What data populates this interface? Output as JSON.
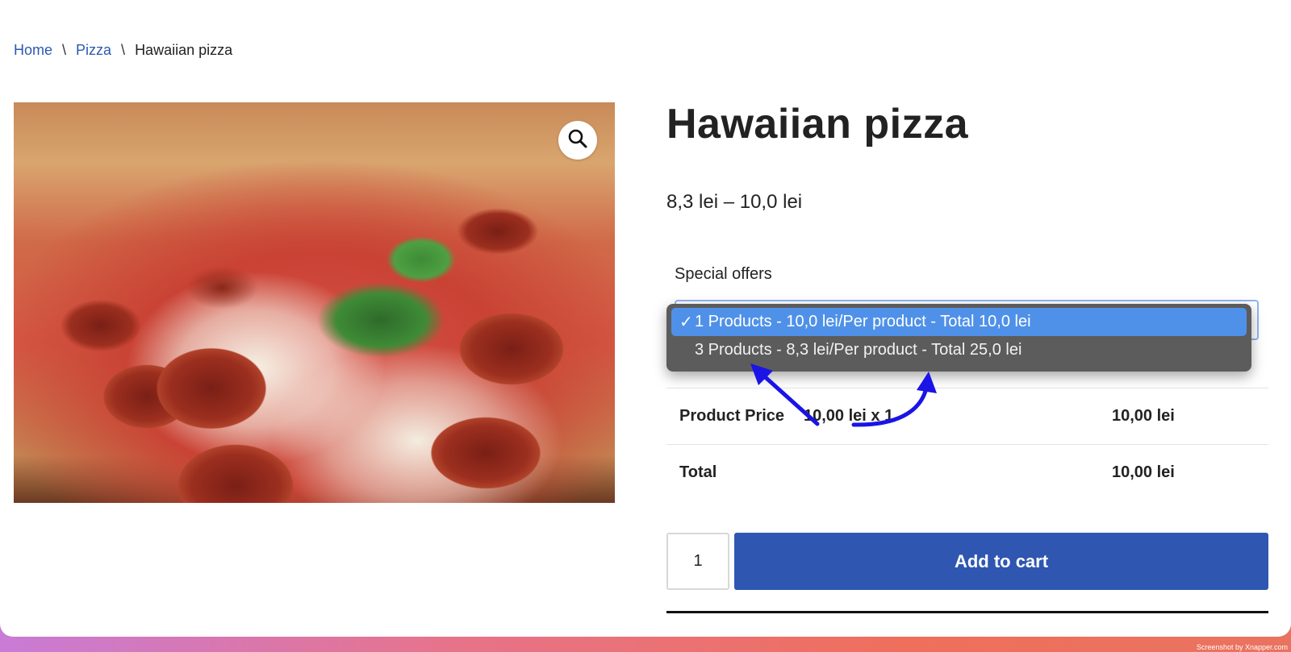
{
  "breadcrumb": {
    "home": "Home",
    "sep1": "\\",
    "category": "Pizza",
    "sep2": "\\",
    "current": "Hawaiian pizza"
  },
  "product": {
    "title": "Hawaiian pizza",
    "price_range": "8,3 lei – 10,0 lei"
  },
  "offers": {
    "label": "Special offers",
    "options": [
      {
        "label": "1 Products - 10,0 lei/Per product - Total 10,0 lei",
        "selected": true
      },
      {
        "label": "3 Products - 8,3 lei/Per product - Total 25,0 lei",
        "selected": false
      }
    ],
    "check_mark": "✓"
  },
  "summary": {
    "product_price_label": "Product Price",
    "product_price_detail": "10,00 lei x 1",
    "product_price_value": "10,00 lei",
    "total_label": "Total",
    "total_value": "10,00 lei"
  },
  "cart": {
    "quantity": "1",
    "button_label": "Add to cart"
  },
  "colors": {
    "link": "#2c59b0",
    "button": "#2f57b1",
    "selected_option": "#4f91e8",
    "annotation_arrow": "#1a14e6"
  },
  "icons": {
    "zoom": "magnifier-icon"
  },
  "watermark": "Screenshot by Xnapper.com"
}
